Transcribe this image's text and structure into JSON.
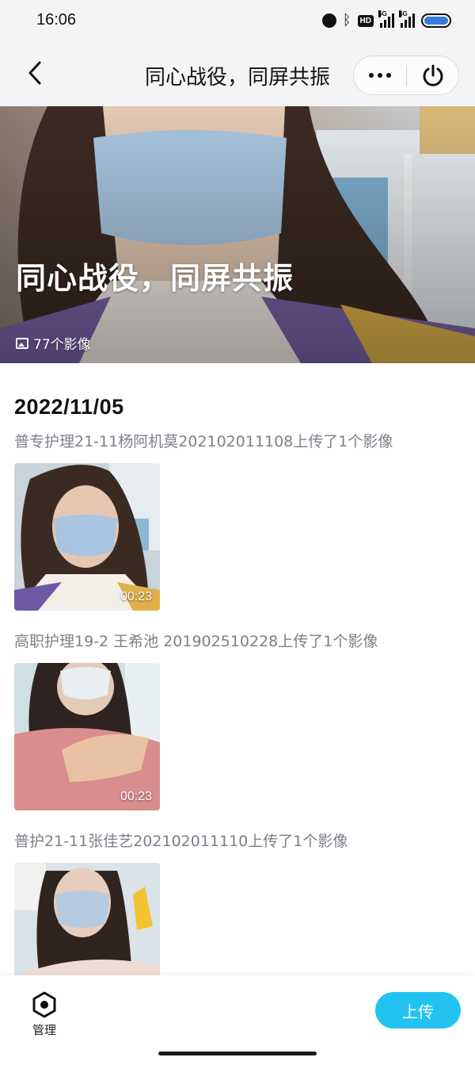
{
  "status_bar": {
    "time": "16:06",
    "icons": [
      "alarm-icon",
      "bluetooth-icon",
      "hd-icon",
      "5g-signal-icon",
      "4g-signal-icon",
      "battery-icon"
    ],
    "hd_label": "HD",
    "net1": "5G",
    "net2": "4G"
  },
  "nav": {
    "title": "同心战役，同屏共振",
    "back_icon": "chevron-left-icon",
    "more_icon": "more-dots-icon",
    "power_icon": "power-icon"
  },
  "banner": {
    "title": "同心战役，同屏共振",
    "count": "77个影像"
  },
  "feed": {
    "date": "2022/11/05",
    "entries": [
      {
        "text": "普专护理21-11杨阿机莫202102011108上传了1个影像",
        "duration": "00:23"
      },
      {
        "text": "高职护理19-2 王希池 201902510228上传了1个影像",
        "duration": "00:23"
      },
      {
        "text": "普护21-11张佳艺202102011110上传了1个影像",
        "duration": ""
      }
    ]
  },
  "bottom_bar": {
    "manage_label": "管理",
    "upload_label": "上传"
  },
  "colors": {
    "accent": "#22c3f0",
    "nav_bg": "#f4f4f6",
    "meta_text": "#7d8088"
  }
}
